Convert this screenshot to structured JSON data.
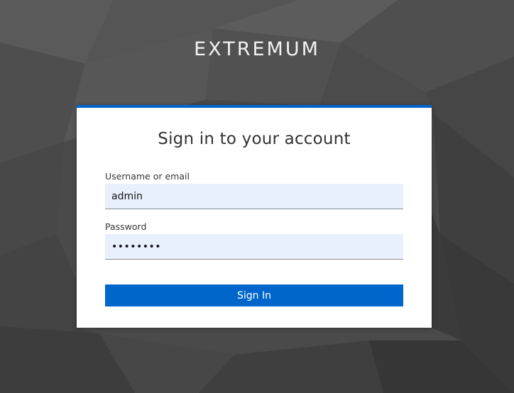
{
  "brand": {
    "name": "EXTREMUM"
  },
  "login_form": {
    "title": "Sign in to your account",
    "username": {
      "label": "Username or email",
      "value": "admin"
    },
    "password": {
      "label": "Password",
      "value": "••••••••"
    },
    "submit_label": "Sign In"
  },
  "colors": {
    "accent": "#0066cc",
    "field_background": "#e8f0fe",
    "card_background": "#ffffff",
    "page_background": "#4a4a4a"
  }
}
